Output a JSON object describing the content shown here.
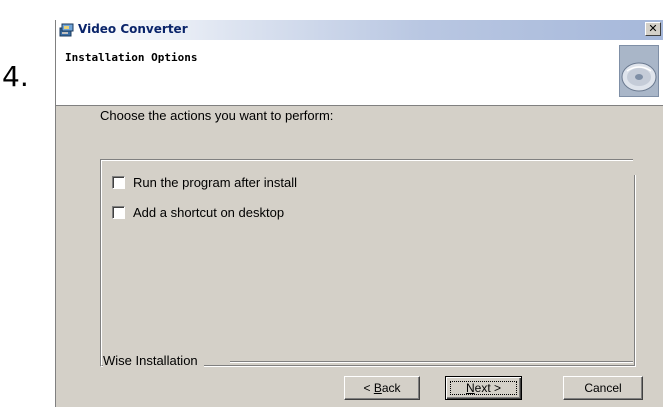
{
  "step_label": "4.",
  "window": {
    "title": "Video Converter",
    "close_glyph": "✕"
  },
  "header": {
    "title": "Installation Options",
    "icon": "cd-disc-icon"
  },
  "prompt": "Choose the actions you want to perform:",
  "options": [
    {
      "label": "Run the program after install",
      "checked": false
    },
    {
      "label": "Add a shortcut on desktop",
      "checked": false
    }
  ],
  "brand": "Wise Installation",
  "buttons": {
    "back_prefix": "< ",
    "back_accel": "B",
    "back_rest": "ack",
    "next_accel": "N",
    "next_rest": "ext >",
    "cancel": "Cancel"
  }
}
